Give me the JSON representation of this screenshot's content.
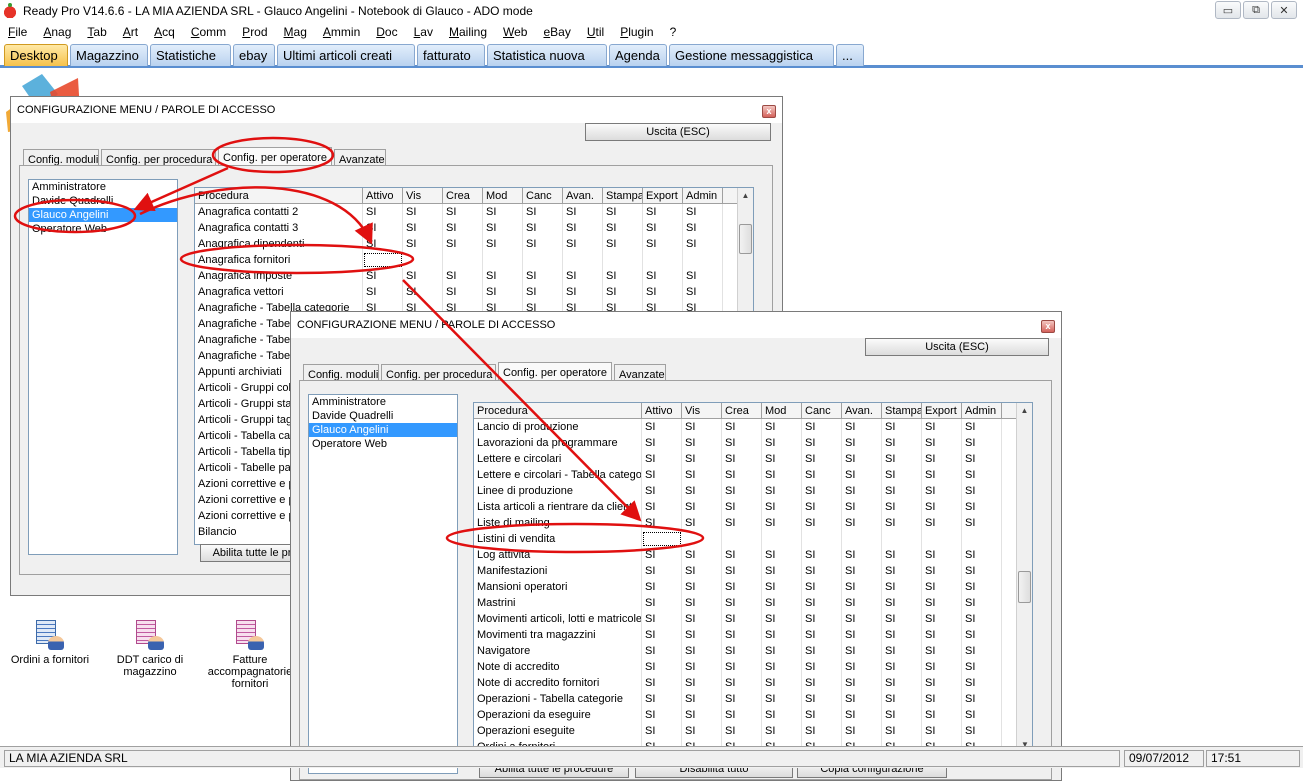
{
  "app": {
    "title": "Ready Pro V14.6.6 - LA MIA AZIENDA SRL - Glauco Angelini - Notebook di Glauco - ADO mode",
    "window_buttons": {
      "minimize": "▭",
      "restore": "⧉",
      "close": "✕"
    }
  },
  "menu": [
    "File",
    "Anag",
    "Tab",
    "Art",
    "Acq",
    "Comm",
    "Prod",
    "Mag",
    "Ammin",
    "Doc",
    "Lav",
    "Mailing",
    "Web",
    "eBay",
    "Util",
    "Plugin",
    "?"
  ],
  "tabs": [
    "Desktop",
    "Magazzino",
    "Statistiche",
    "ebay",
    "Ultimi articoli creati",
    "fatturato",
    "Statistica nuova",
    "Agenda",
    "Gestione messaggistica",
    "..."
  ],
  "active_tab": "Desktop",
  "dialog": {
    "title": "CONFIGURAZIONE MENU / PAROLE DI ACCESSO",
    "exit_label": "Uscita (ESC)",
    "close_glyph": "x",
    "subtabs": [
      "Config. moduli",
      "Config. per procedura",
      "Config. per operatore",
      "Avanzate"
    ],
    "operators": [
      "Amministratore",
      "Davide Quadrelli",
      "Glauco Angelini",
      "Operatore Web"
    ],
    "selected_operator": "Glauco Angelini",
    "columns": [
      "Procedura",
      "Attivo",
      "Vis",
      "Crea",
      "Mod",
      "Canc",
      "Avan.",
      "Stampa",
      "Export",
      "Admin"
    ],
    "yes": "SI"
  },
  "dialog1": {
    "rows": [
      {
        "name": "Anagrafica contatti 2",
        "perm": true
      },
      {
        "name": "Anagrafica contatti 3",
        "perm": true
      },
      {
        "name": "Anagrafica dipendenti",
        "perm": true
      },
      {
        "name": "Anagrafica fornitori",
        "perm": false
      },
      {
        "name": "Anagrafica imposte",
        "perm": true
      },
      {
        "name": "Anagrafica vettori",
        "perm": true
      },
      {
        "name": "Anagrafiche - Tabella categorie",
        "perm": true
      },
      {
        "name": "Anagrafiche - Tabe",
        "perm": true
      },
      {
        "name": "Anagrafiche - Tabe",
        "perm": true
      },
      {
        "name": "Anagrafiche - Tabe",
        "perm": true
      },
      {
        "name": "Appunti archiviati",
        "perm": true
      },
      {
        "name": "Articoli - Gruppi colo",
        "perm": true
      },
      {
        "name": "Articoli - Gruppi stag",
        "perm": true
      },
      {
        "name": "Articoli - Gruppi tagl",
        "perm": true
      },
      {
        "name": "Articoli - Tabella cat",
        "perm": true
      },
      {
        "name": "Articoli - Tabella tipi",
        "perm": true
      },
      {
        "name": "Articoli - Tabelle pa",
        "perm": true
      },
      {
        "name": "Azioni correttive e p",
        "perm": true
      },
      {
        "name": "Azioni correttive e p",
        "perm": true
      },
      {
        "name": "Azioni correttive e p",
        "perm": true
      },
      {
        "name": "Bilancio",
        "perm": true
      }
    ],
    "bottom_button": "Abilita tutte le pr"
  },
  "dialog2": {
    "rows": [
      {
        "name": "Lancio di produzione",
        "perm": true
      },
      {
        "name": "Lavorazioni da programmare",
        "perm": true
      },
      {
        "name": "Lettere e circolari",
        "perm": true
      },
      {
        "name": "Lettere e circolari - Tabella catego",
        "perm": true
      },
      {
        "name": "Linee di produzione",
        "perm": true
      },
      {
        "name": "Lista articoli a rientrare da clienti",
        "perm": true
      },
      {
        "name": "Liste di mailing",
        "perm": true
      },
      {
        "name": "Listini di vendita",
        "perm": false
      },
      {
        "name": "Log attività",
        "perm": true
      },
      {
        "name": "Manifestazioni",
        "perm": true
      },
      {
        "name": "Mansioni operatori",
        "perm": true
      },
      {
        "name": "Mastrini",
        "perm": true
      },
      {
        "name": "Movimenti articoli, lotti e matricole",
        "perm": true
      },
      {
        "name": "Movimenti tra magazzini",
        "perm": true
      },
      {
        "name": "Navigatore",
        "perm": true
      },
      {
        "name": "Note di accredito",
        "perm": true
      },
      {
        "name": "Note di accredito fornitori",
        "perm": true
      },
      {
        "name": "Operazioni - Tabella categorie",
        "perm": true
      },
      {
        "name": "Operazioni da eseguire",
        "perm": true
      },
      {
        "name": "Operazioni eseguite",
        "perm": true
      },
      {
        "name": "Ordini a fornitori",
        "perm": true
      }
    ],
    "bottom_buttons": [
      "Abilita tutte le procedure",
      "Disabilita tutto",
      "Copia configurazione"
    ]
  },
  "desktop_icons": [
    {
      "label": "Ordini a fornitori",
      "icon": "order-icon"
    },
    {
      "label": "DDT carico di magazzino",
      "icon": "ddt-icon"
    },
    {
      "label": "Fatture accompagnatorie fornitori",
      "icon": "invoice-icon"
    }
  ],
  "status": {
    "company": "LA MIA AZIENDA SRL",
    "date": "09/07/2012",
    "time": "17:51"
  },
  "colors": {
    "tab_active": "#f6c24c",
    "tab_bg": "#c6dbf3",
    "tab_bar": "#5a8ed0",
    "selection": "#3399ff",
    "annotation": "#e01010"
  }
}
